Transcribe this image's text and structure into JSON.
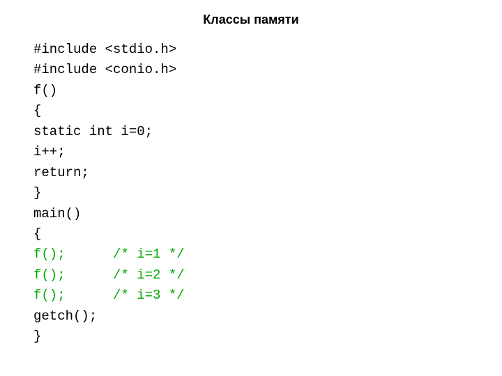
{
  "title": "Классы памяти",
  "code": {
    "lines": [
      {
        "text": "#include <stdio.h>",
        "color": "black"
      },
      {
        "text": "#include <conio.h>",
        "color": "black"
      },
      {
        "text": "f()",
        "color": "black"
      },
      {
        "text": "{",
        "color": "black"
      },
      {
        "text": "static int i=0;",
        "color": "black"
      },
      {
        "text": "i++;",
        "color": "black"
      },
      {
        "text": "return;",
        "color": "black"
      },
      {
        "text": "}",
        "color": "black"
      },
      {
        "text": "main()",
        "color": "black"
      },
      {
        "text": "{",
        "color": "black"
      },
      {
        "text": "f();      /* i=1 */",
        "color": "green"
      },
      {
        "text": "f();      /* i=2 */",
        "color": "green"
      },
      {
        "text": "f();      /* i=3 */",
        "color": "green"
      },
      {
        "text": "getch();",
        "color": "black"
      },
      {
        "text": "}",
        "color": "black"
      }
    ]
  }
}
